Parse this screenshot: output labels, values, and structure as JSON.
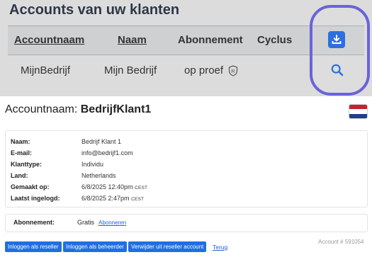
{
  "overview": {
    "title": "Accounts van uw klanten",
    "columns": [
      {
        "label": "Accountnaam",
        "sortable": true
      },
      {
        "label": "Naam",
        "sortable": true
      },
      {
        "label": "Abonnement",
        "sortable": false
      },
      {
        "label": "Cyclus",
        "sortable": false
      }
    ],
    "row": {
      "accountnaam": "MijnBedrijf",
      "naam": "Mijn Bedrijf",
      "abonnement": "op proef",
      "badge_letter": "R"
    },
    "icons": {
      "download": "download-icon",
      "search": "search-icon"
    },
    "highlight_color": "#6a63d9"
  },
  "account": {
    "title_label": "Accountnaam:",
    "title_value": "BedrijfKlant1",
    "flag": "netherlands-flag",
    "details": [
      {
        "label": "Naam:",
        "value": "Bedrijf Klant 1"
      },
      {
        "label": "E-mail:",
        "value": "info@bedrijf1.com"
      },
      {
        "label": "Klanttype:",
        "value": "Individu"
      },
      {
        "label": "Land:",
        "value": "Netherlands"
      },
      {
        "label": "Gemaakt op:",
        "value": "6/8/2025 12:40pm",
        "tz": "CEST"
      },
      {
        "label": "Laatst ingelogd:",
        "value": "6/8/2025 2:47pm",
        "tz": "CEST"
      }
    ],
    "subscription": {
      "label": "Abonnement:",
      "value": "Gratis",
      "link": "Abonneren"
    },
    "actions": {
      "login_reseller": "Inloggen als reseller",
      "login_admin": "Inloggen als beheerder",
      "remove_reseller": "Verwijder uit reseller account",
      "back": "Terug"
    },
    "account_number": "Account # 591054"
  },
  "colors": {
    "primary_button": "#1f6fe0",
    "link": "#2462d8"
  }
}
